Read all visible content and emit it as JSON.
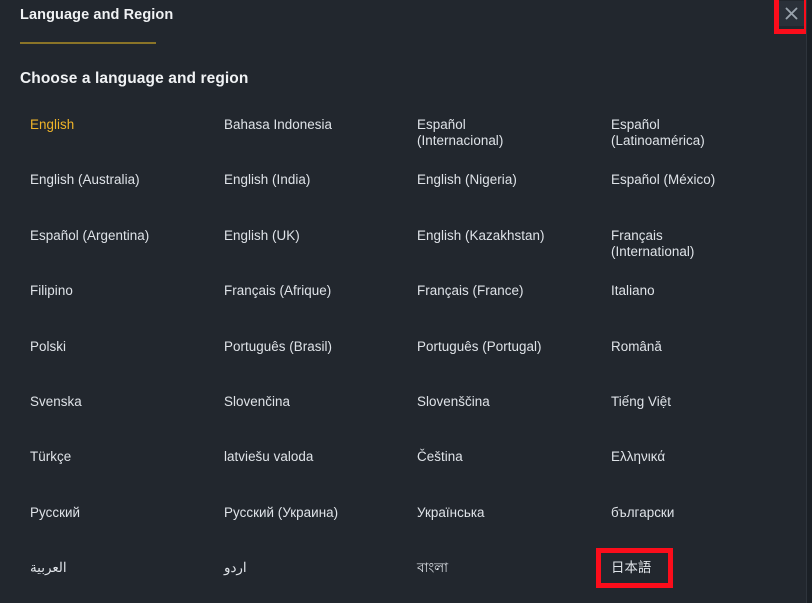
{
  "header": {
    "title": "Language and Region",
    "close_icon": "close-icon"
  },
  "section": {
    "heading": "Choose a language and region"
  },
  "colors": {
    "background": "#22272e",
    "text": "#dfe3e8",
    "selected_accent": "#f0b429",
    "title_underline": "#8a7428",
    "annotation_highlight": "#fc0d1b"
  },
  "languages": [
    {
      "label": "English",
      "selected": true,
      "rtl": false
    },
    {
      "label": "Bahasa Indonesia",
      "selected": false,
      "rtl": false
    },
    {
      "label": "Español\n(Internacional)",
      "selected": false,
      "rtl": false
    },
    {
      "label": "Español\n(Latinoamérica)",
      "selected": false,
      "rtl": false
    },
    {
      "label": "English (Australia)",
      "selected": false,
      "rtl": false
    },
    {
      "label": "English (India)",
      "selected": false,
      "rtl": false
    },
    {
      "label": "English (Nigeria)",
      "selected": false,
      "rtl": false
    },
    {
      "label": "Español (México)",
      "selected": false,
      "rtl": false
    },
    {
      "label": "Español (Argentina)",
      "selected": false,
      "rtl": false
    },
    {
      "label": "English (UK)",
      "selected": false,
      "rtl": false
    },
    {
      "label": "English (Kazakhstan)",
      "selected": false,
      "rtl": false
    },
    {
      "label": "Français\n(International)",
      "selected": false,
      "rtl": false
    },
    {
      "label": "Filipino",
      "selected": false,
      "rtl": false
    },
    {
      "label": "Français (Afrique)",
      "selected": false,
      "rtl": false
    },
    {
      "label": "Français (France)",
      "selected": false,
      "rtl": false
    },
    {
      "label": "Italiano",
      "selected": false,
      "rtl": false
    },
    {
      "label": "Polski",
      "selected": false,
      "rtl": false
    },
    {
      "label": "Português (Brasil)",
      "selected": false,
      "rtl": false
    },
    {
      "label": "Português (Portugal)",
      "selected": false,
      "rtl": false
    },
    {
      "label": "Română",
      "selected": false,
      "rtl": false
    },
    {
      "label": "Svenska",
      "selected": false,
      "rtl": false
    },
    {
      "label": "Slovenčina",
      "selected": false,
      "rtl": false
    },
    {
      "label": "Slovenščina",
      "selected": false,
      "rtl": false
    },
    {
      "label": "Tiếng Việt",
      "selected": false,
      "rtl": false
    },
    {
      "label": "Türkçe",
      "selected": false,
      "rtl": false
    },
    {
      "label": "latviešu valoda",
      "selected": false,
      "rtl": false
    },
    {
      "label": "Čeština",
      "selected": false,
      "rtl": false
    },
    {
      "label": "Ελληνικά",
      "selected": false,
      "rtl": false
    },
    {
      "label": "Русский",
      "selected": false,
      "rtl": false
    },
    {
      "label": "Русский (Украина)",
      "selected": false,
      "rtl": false
    },
    {
      "label": "Українська",
      "selected": false,
      "rtl": false
    },
    {
      "label": "български",
      "selected": false,
      "rtl": false
    },
    {
      "label": "العربية",
      "selected": false,
      "rtl": true
    },
    {
      "label": "اردو",
      "selected": false,
      "rtl": true
    },
    {
      "label": "বাংলা",
      "selected": false,
      "rtl": false
    },
    {
      "label": "日本語",
      "selected": false,
      "rtl": false
    }
  ]
}
